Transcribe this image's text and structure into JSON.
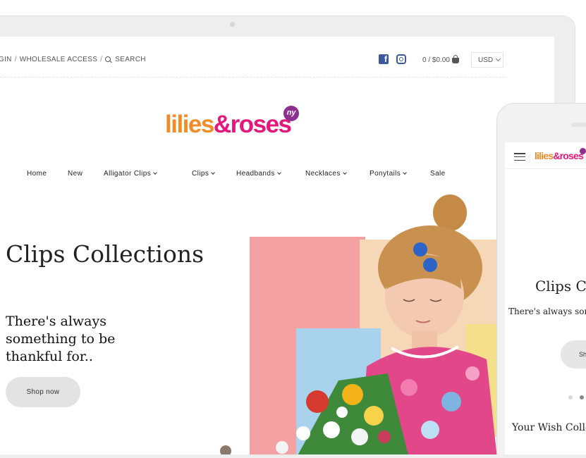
{
  "topbar": {
    "login": "GIN",
    "sep1": "/",
    "wholesale": "WHOLESALE ACCESS",
    "sep2": "/",
    "search": "SEARCH",
    "cart": "0 / $0.00",
    "currency": "USD"
  },
  "logo": {
    "part1": "lilies",
    "part2": "&roses",
    "badge": "ny"
  },
  "nav": {
    "items": [
      {
        "label": "Home",
        "dropdown": false
      },
      {
        "label": "New",
        "dropdown": false
      },
      {
        "label": "Alligator Clips",
        "dropdown": true
      },
      {
        "label": "Clips",
        "dropdown": true
      },
      {
        "label": "Headbands",
        "dropdown": true
      },
      {
        "label": "Necklaces",
        "dropdown": true
      },
      {
        "label": "Ponytails",
        "dropdown": true
      },
      {
        "label": "Sale",
        "dropdown": false
      }
    ]
  },
  "hero": {
    "title": "Clips Collections",
    "subtitle": "There's always something to be thankful for..",
    "button": "Shop now"
  },
  "phone": {
    "logo1": "lilies",
    "logo2": "&roses",
    "title": "Clips C",
    "subtitle": "There's always sor",
    "button": "Sh",
    "wish": "Your Wish Colle"
  },
  "colors": {
    "brand_orange": "#f28c28",
    "brand_pink": "#e5177c",
    "badge_purple": "#8d2f8f",
    "facebook": "#3b5998"
  },
  "icons": [
    "search-icon",
    "facebook-icon",
    "instagram-icon",
    "cart-icon",
    "chevron-down-icon",
    "menu-icon"
  ]
}
